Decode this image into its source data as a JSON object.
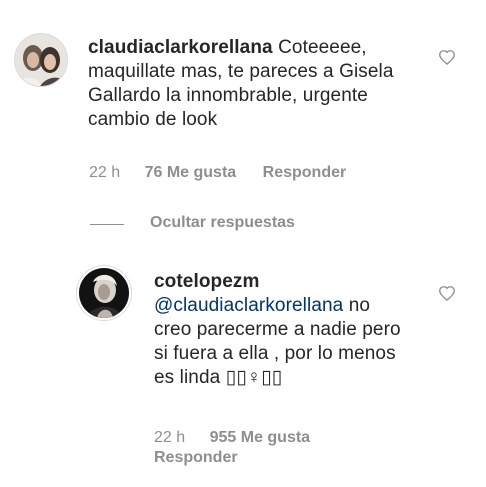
{
  "comment": {
    "username": "claudiaclarkorellana",
    "text": "Coteeeee, maquillate mas, te pareces a Gisela Gallardo la innombrable, urgente cambio de look",
    "time": "22 h",
    "likes": "76 Me gusta",
    "reply_label": "Responder",
    "like_icon": "heart-outline-icon"
  },
  "hide_replies_label": "Ocultar respuestas",
  "reply": {
    "username": "cotelopezm",
    "mention": "@claudiaclarkorellana",
    "text": "no creo parecerme a nadie pero si fuera a ella , por lo menos es linda ▯▯♀▯▯",
    "time": "22 h",
    "likes": "955 Me gusta",
    "reply_label": "Responder",
    "like_icon": "heart-outline-icon"
  },
  "colors": {
    "text": "#262626",
    "secondary": "#8e8e8e",
    "mention": "#003569",
    "background": "#ffffff"
  }
}
